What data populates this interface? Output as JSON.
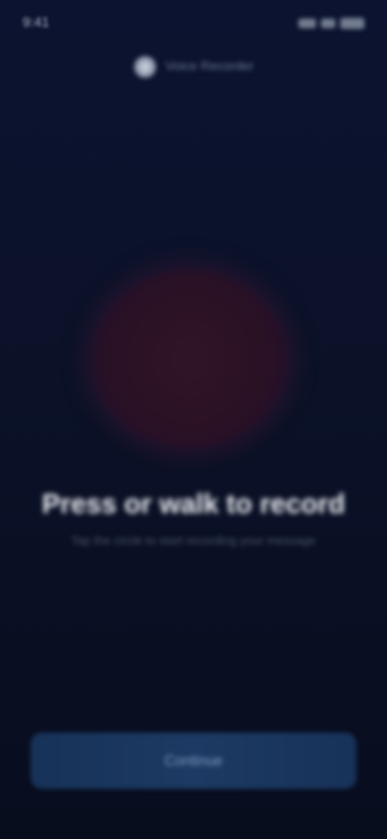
{
  "status_bar": {
    "time": "9:41",
    "icons": [
      "signal-icon",
      "wifi-icon",
      "battery-icon"
    ]
  },
  "header": {
    "title": "Voice Recorder"
  },
  "record": {
    "circle_color": "#2b1124"
  },
  "prompt": {
    "title": "Press or walk to record",
    "subtitle": "Tap the circle to start recording your message"
  },
  "primary_button": {
    "label": "Continue",
    "color": "#1c3a63"
  }
}
